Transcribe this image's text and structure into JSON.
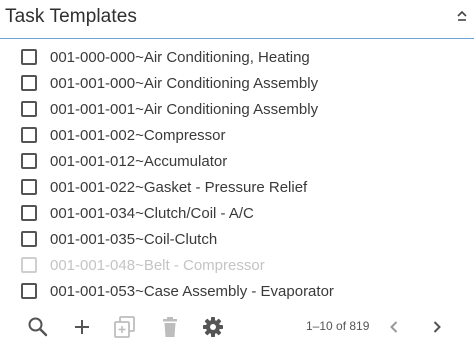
{
  "panel": {
    "title": "Task Templates"
  },
  "items": [
    {
      "label": "001-000-000~Air Conditioning, Heating",
      "checked": false,
      "disabled": false
    },
    {
      "label": "001-001-000~Air Conditioning Assembly",
      "checked": false,
      "disabled": false
    },
    {
      "label": "001-001-001~Air Conditioning Assembly",
      "checked": false,
      "disabled": false
    },
    {
      "label": "001-001-002~Compressor",
      "checked": false,
      "disabled": false
    },
    {
      "label": "001-001-012~Accumulator",
      "checked": false,
      "disabled": false
    },
    {
      "label": "001-001-022~Gasket - Pressure Relief",
      "checked": false,
      "disabled": false
    },
    {
      "label": "001-001-034~Clutch/Coil - A/C",
      "checked": false,
      "disabled": false
    },
    {
      "label": "001-001-035~Coil-Clutch",
      "checked": false,
      "disabled": false
    },
    {
      "label": "001-001-048~Belt - Compressor",
      "checked": false,
      "disabled": true
    },
    {
      "label": "001-001-053~Case Assembly - Evaporator",
      "checked": false,
      "disabled": false
    }
  ],
  "toolbar": {
    "icons": [
      "search-icon",
      "plus-icon",
      "copy-icon",
      "trash-icon",
      "gear-icon"
    ],
    "pager_text": "1–10 of 819"
  },
  "colors": {
    "header_rule": "#6fa3d6",
    "disabled_text": "#c4c4c4",
    "icon": "#555555",
    "icon_disabled": "#bdbdbd"
  }
}
